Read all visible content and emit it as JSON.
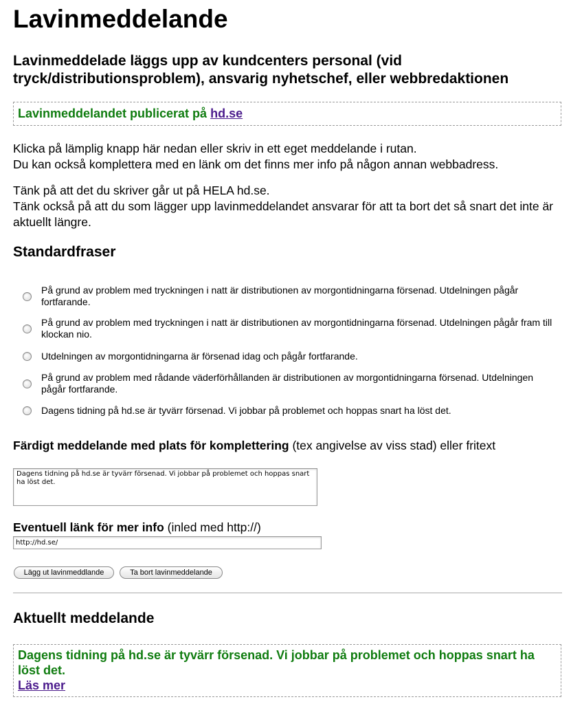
{
  "page": {
    "title": "Lavinmeddelande",
    "subtitle": "Lavinmeddelade läggs upp av kundcenters personal (vid tryck/distributionsproblem), ansvarig nyhetschef, eller webbredaktionen"
  },
  "published": {
    "text": "Lavinmeddelandet publicerat på ",
    "link": "hd.se"
  },
  "instructions": {
    "line1": "Klicka på lämplig knapp här nedan eller skriv in ett eget meddelande i rutan.",
    "line2": "Du kan också komplettera med en länk om det finns mer info på någon annan webbadress.",
    "line3": "Tänk på att det du skriver går ut på HELA hd.se.",
    "line4": "Tänk också på att du som lägger upp lavinmeddelandet ansvarar för att ta bort det så snart det inte är aktuellt längre."
  },
  "standard": {
    "heading": "Standardfraser",
    "options": [
      "På grund av problem med tryckningen i natt är distributionen av morgontidningarna försenad. Utdelningen pågår fortfarande.",
      "På grund av problem med tryckningen i natt är distributionen av morgontidningarna försenad. Utdelningen pågår fram till klockan nio.",
      "Utdelningen av morgontidningarna är försenad idag och pågår fortfarande.",
      "På grund av problem med rådande väderförhållanden är distributionen av morgontidningarna försenad. Utdelningen pågår fortfarande.",
      "Dagens tidning på hd.se är tyvärr försenad. Vi jobbar på problemet och hoppas snart ha löst det."
    ]
  },
  "message": {
    "label_bold": "Färdigt meddelande med plats för komplettering",
    "label_rest": " (tex angivelse av viss stad) eller fritext",
    "value": "Dagens tidning på hd.se är tyvärr försenad. Vi jobbar på problemet och hoppas snart ha löst det."
  },
  "link": {
    "label_bold": "Eventuell länk för mer info",
    "label_rest": " (inled med http://)",
    "value": "http://hd.se/"
  },
  "buttons": {
    "publish": "Lägg ut lavinmeddlande",
    "remove": "Ta bort lavinmeddelande"
  },
  "current": {
    "heading": "Aktuellt meddelande",
    "text": "Dagens tidning på hd.se är tyvärr försenad. Vi jobbar på problemet och hoppas snart ha löst det.",
    "more": "Läs mer"
  },
  "colors": {
    "notice_green": "#0f7c0f",
    "link_purple": "#4b1b8c"
  }
}
